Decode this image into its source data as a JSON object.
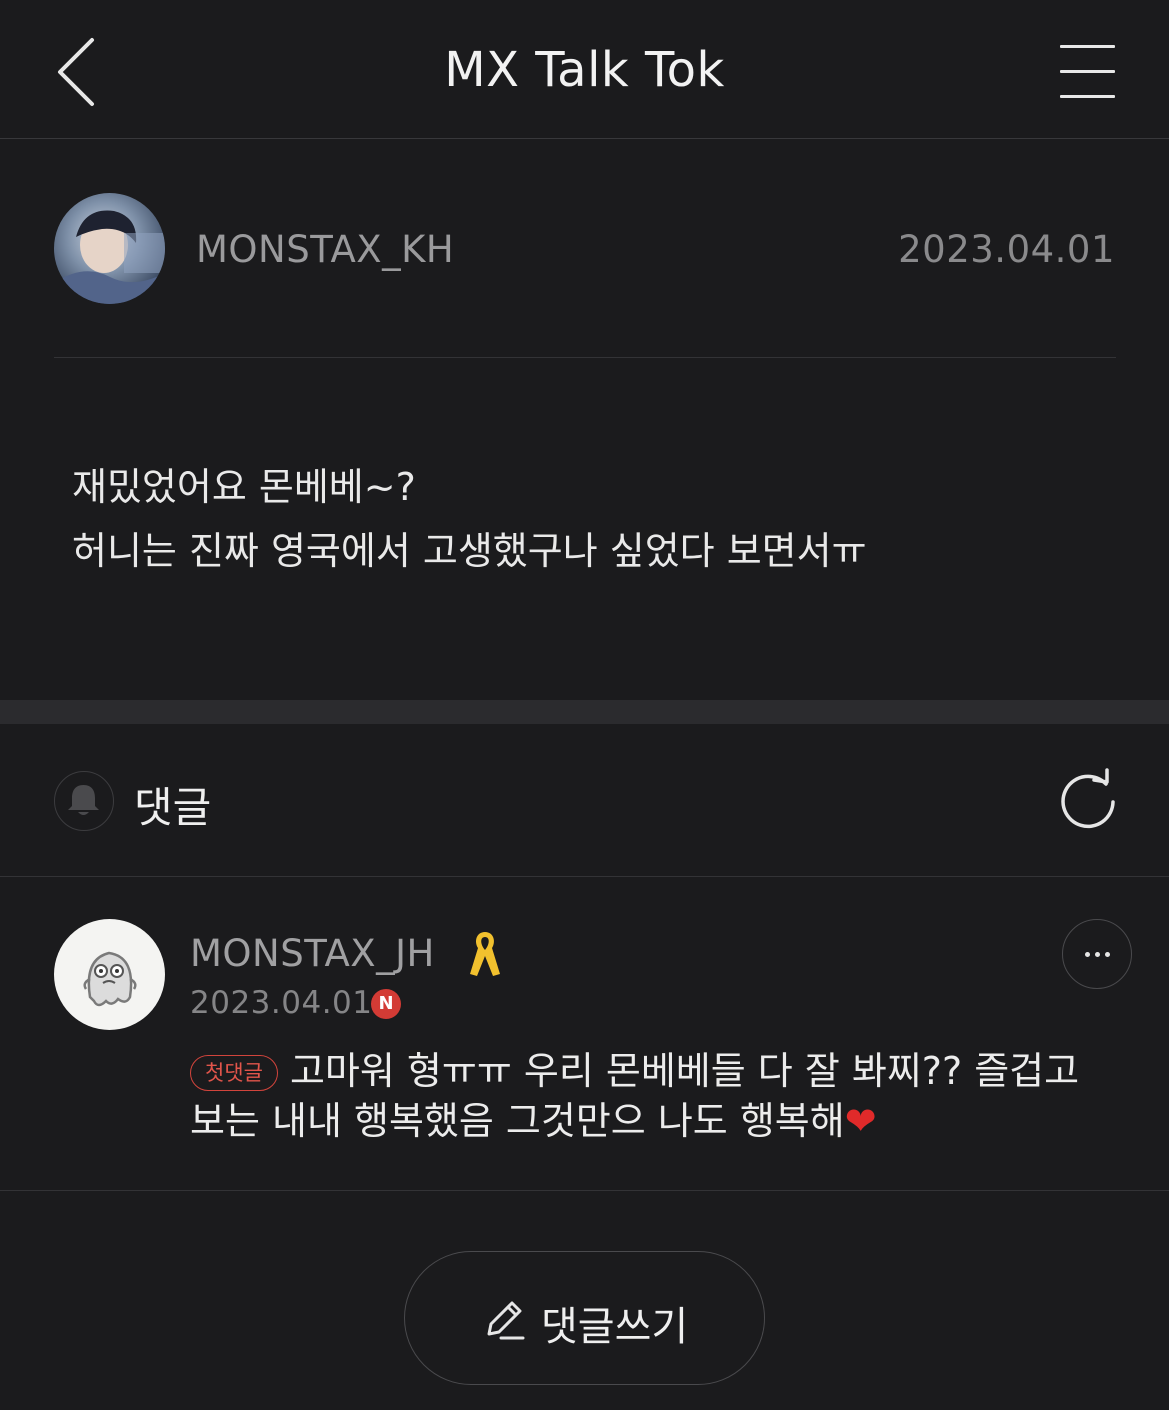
{
  "header": {
    "title": "MX Talk Tok",
    "back_icon": "chevron-left-icon",
    "menu_icon": "hamburger-menu-icon"
  },
  "post": {
    "author": "MONSTAX_KH",
    "date": "2023.04.01",
    "body_line_1": "재밌었어요 몬베베~?",
    "body_line_2": "허니는 진짜 영국에서 고생했구나 싶었다 보면서ㅠ"
  },
  "comments_section": {
    "label": "댓글",
    "bell_icon": "bell-icon",
    "refresh_icon": "refresh-icon"
  },
  "comment": {
    "author": "MONSTAX_JH",
    "date": "2023.04.01",
    "new_badge": "N",
    "first_comment_badge": "첫댓글",
    "text": "고마워 형ㅠㅠ 우리 몬베베들 다 잘 봐찌?? 즐겁고 보는 내내 행복했음 그것만으 나도 행복해",
    "heart": "❤"
  },
  "write_button": {
    "label": "댓글쓰기",
    "icon": "pencil-icon"
  },
  "colors": {
    "background": "#1b1b1d",
    "accent_red": "#d33b35",
    "ribbon_yellow": "#f2c12e"
  }
}
